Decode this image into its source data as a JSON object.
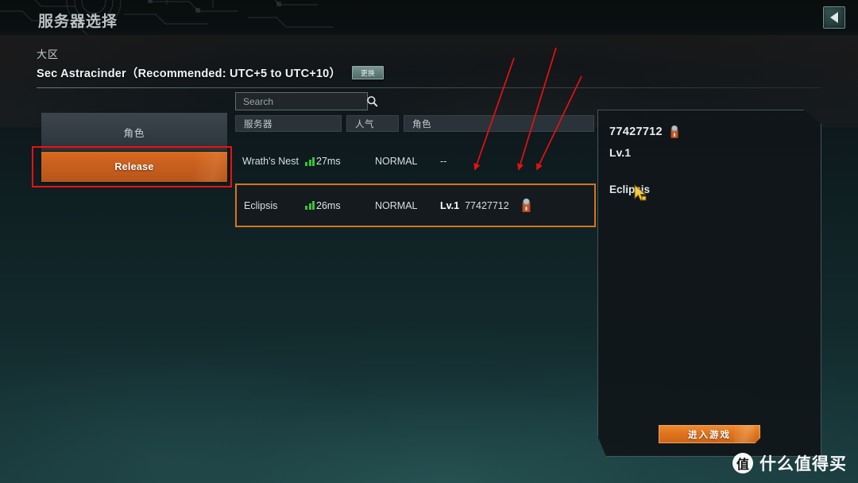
{
  "header": {
    "title": "服务器选择",
    "back_icon": "back-arrow-icon"
  },
  "region": {
    "label": "大区",
    "name": "Sec Astracinder（Recommended: UTC+5 to UTC+10）",
    "change_button": "更换"
  },
  "sidebar": {
    "items": [
      {
        "label": "角色",
        "selected": false
      },
      {
        "label": "Release",
        "selected": true
      }
    ]
  },
  "search": {
    "value": "",
    "placeholder": "Search",
    "icon": "search-icon"
  },
  "table": {
    "columns": [
      "服务器",
      "人气",
      "角色"
    ],
    "rows": [
      {
        "server": "Wrath's Nest",
        "ping": "27ms",
        "signal_icon": "signal-bars-icon",
        "popularity": "NORMAL",
        "character_level": "",
        "character_uid": "--",
        "selected": false
      },
      {
        "server": "Eclipsis",
        "ping": "26ms",
        "signal_icon": "signal-bars-icon",
        "popularity": "NORMAL",
        "character_level": "Lv.1",
        "character_uid": "77427712",
        "avatar_icon": "character-avatar-icon",
        "selected": true
      }
    ]
  },
  "character_panel": {
    "uid": "77427712",
    "avatar_icon": "character-avatar-icon",
    "level": "Lv.1",
    "server": "Eclipsis"
  },
  "enter_button": {
    "label": "进入游戏"
  },
  "watermark": {
    "logo": "值",
    "text": "什么值得买"
  },
  "colors": {
    "accent_orange": "#d4751f",
    "release_orange": "#c9601e",
    "annotation_red": "#f01010",
    "signal_green": "#36c736",
    "panel_bg": "#101519",
    "header_bg": "#0a0f10"
  }
}
